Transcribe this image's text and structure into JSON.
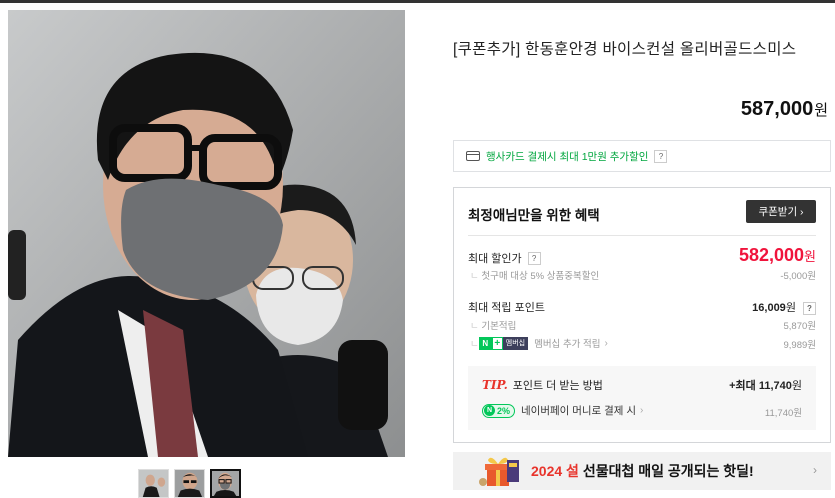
{
  "product": {
    "title": "[쿠폰추가] 한동훈안경 바이스컨설 올리버골드스미스",
    "price": "587,000",
    "currency": "원"
  },
  "card_promo": {
    "text": "행사카드 결제시 최대 1만원 추가할인",
    "help": "?"
  },
  "benefit": {
    "title": "최정애님만을 위한 혜택",
    "coupon_button": "쿠폰받기 ›",
    "max_discount_label": "최대 할인가",
    "max_discount_help": "?",
    "max_discount_price": "582,000",
    "first_purchase_label": "첫구매 대상 5% 상품중복할인",
    "first_purchase_value": "-5,000원",
    "points_label": "최대 적립 포인트",
    "points_help": "?",
    "points_value": "16,009",
    "basic_label": "기본적립",
    "basic_value": "5,870원",
    "membership_badge": "멤버십",
    "membership_label": "멤버십 추가 적립",
    "membership_value": "9,989원",
    "tip_mark": "TIP.",
    "tip_title": "포인트 더 받는 방법",
    "tip_max": "+최대 11,740",
    "npay_badge": "2%",
    "npay_label": "네이버페이 머니로 결제 시",
    "npay_value": "11,740원"
  },
  "banner": {
    "year": "2024 설",
    "text": "선물대첩 매일 공개되는 핫딜!"
  },
  "icons": [
    "card-icon",
    "chevron-right-icon",
    "naverpay-n-icon",
    "gift-icon"
  ],
  "colors": {
    "accent_red": "#f0143c",
    "naver_green": "#03c75a",
    "card_promo_green": "#00a63e"
  }
}
